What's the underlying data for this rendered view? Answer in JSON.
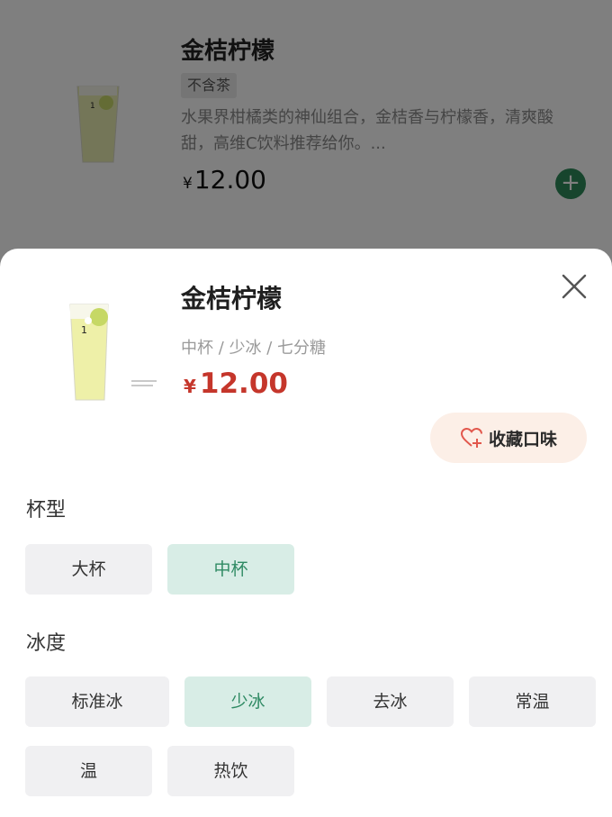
{
  "background_item": {
    "title": "金桔柠檬",
    "tag": "不含茶",
    "description": "水果界柑橘类的神仙组合，金桔香与柠檬香，清爽酸甜，高维C饮料推荐给你。...",
    "currency": "¥",
    "price": "12.00",
    "add_icon": "plus-circle-icon"
  },
  "sheet": {
    "title": "金桔柠檬",
    "selection_summary": "中杯 / 少冰 / 七分糖",
    "currency": "¥",
    "price": "12.00",
    "close_icon": "close-icon",
    "favorite_label": "收藏口味",
    "favorite_icon": "heart-plus-icon",
    "accent_color": "#2e8a63",
    "price_color": "#c5362b"
  },
  "cup_size": {
    "label": "杯型",
    "options": [
      "大杯",
      "中杯"
    ],
    "selected": "中杯"
  },
  "ice": {
    "label": "冰度",
    "options": [
      "标准冰",
      "少冰",
      "去冰",
      "常温",
      "温",
      "热饮"
    ],
    "selected": "少冰"
  }
}
